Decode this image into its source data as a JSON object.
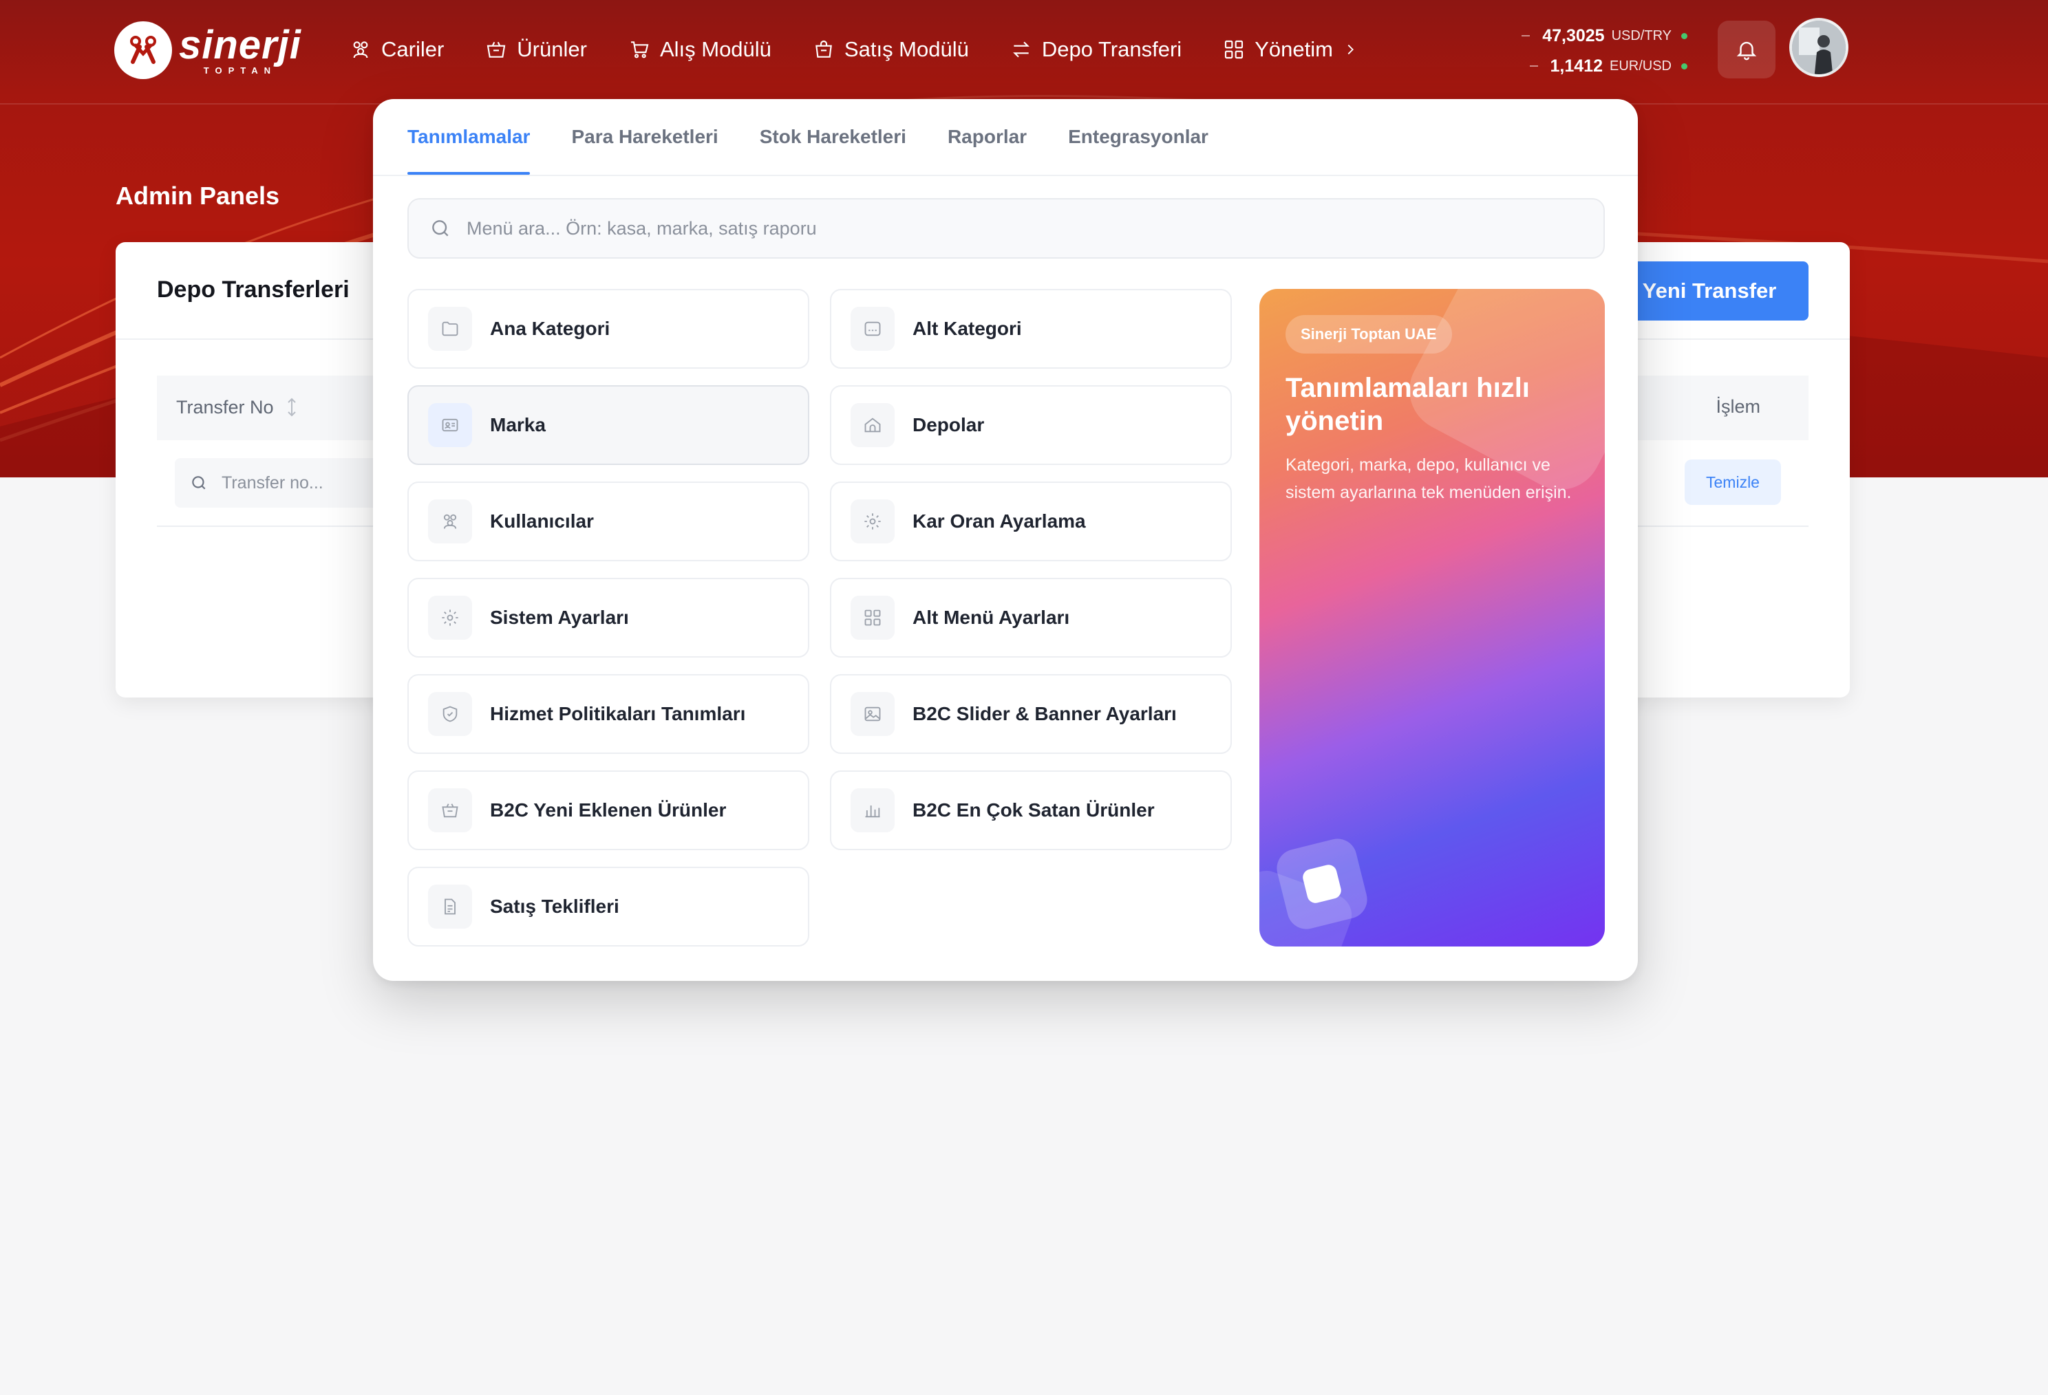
{
  "header": {
    "logo_text": "sinerji",
    "logo_subtext": "TOPTAN",
    "nav": [
      {
        "label": "Cariler",
        "icon": "users-icon"
      },
      {
        "label": "Ürünler",
        "icon": "basket-icon"
      },
      {
        "label": "Alış Modülü",
        "icon": "cart-icon"
      },
      {
        "label": "Satış Modülü",
        "icon": "shopping-bag-icon"
      },
      {
        "label": "Depo Transferi",
        "icon": "transfer-arrows-icon"
      },
      {
        "label": "Yönetim",
        "icon": "grid-icon"
      }
    ],
    "rates": [
      {
        "value": "47,3025",
        "pair": "USD/TRY"
      },
      {
        "value": "1,1412",
        "pair": "EUR/USD"
      }
    ]
  },
  "page": {
    "title": "Admin Panels"
  },
  "card": {
    "title": "Depo Transferleri",
    "new_button": "Yeni Transfer",
    "columns": {
      "transfer_no": "Transfer No",
      "action": "İşlem"
    },
    "filter_placeholder": "Transfer no...",
    "clear_button": "Temizle"
  },
  "menu": {
    "tabs": [
      "Tanımlamalar",
      "Para Hareketleri",
      "Stok Hareketleri",
      "Raporlar",
      "Entegrasyonlar"
    ],
    "active_tab": "Tanımlamalar",
    "search_placeholder": "Menü ara... Örn: kasa, marka, satış raporu",
    "items": [
      {
        "label": "Ana Kategori",
        "icon": "folder-icon"
      },
      {
        "label": "Alt Kategori",
        "icon": "subcategory-icon"
      },
      {
        "label": "Marka",
        "icon": "id-card-icon"
      },
      {
        "label": "Depolar",
        "icon": "warehouse-icon"
      },
      {
        "label": "Kullanıcılar",
        "icon": "users-icon"
      },
      {
        "label": "Kar Oran Ayarlama",
        "icon": "gear-icon"
      },
      {
        "label": "Sistem Ayarları",
        "icon": "gear-icon"
      },
      {
        "label": "Alt Menü Ayarları",
        "icon": "grid-icon"
      },
      {
        "label": "Hizmet Politikaları Tanımları",
        "icon": "shield-icon"
      },
      {
        "label": "B2C Slider & Banner Ayarları",
        "icon": "image-icon"
      },
      {
        "label": "B2C Yeni Eklenen Ürünler",
        "icon": "basket-icon"
      },
      {
        "label": "B2C En Çok Satan Ürünler",
        "icon": "bar-chart-icon"
      },
      {
        "label": "Satış Teklifleri",
        "icon": "document-icon"
      }
    ],
    "promo": {
      "badge": "Sinerji Toptan UAE",
      "title": "Tanımlamaları hızlı yönetin",
      "text": "Kategori, marka, depo, kullanıcı ve sistem ayarlarına tek menüden erişin."
    }
  },
  "colors": {
    "brand_red": "#b3180e",
    "accent_blue": "#3b82f6",
    "rate_dot_green": "#46c86e"
  }
}
